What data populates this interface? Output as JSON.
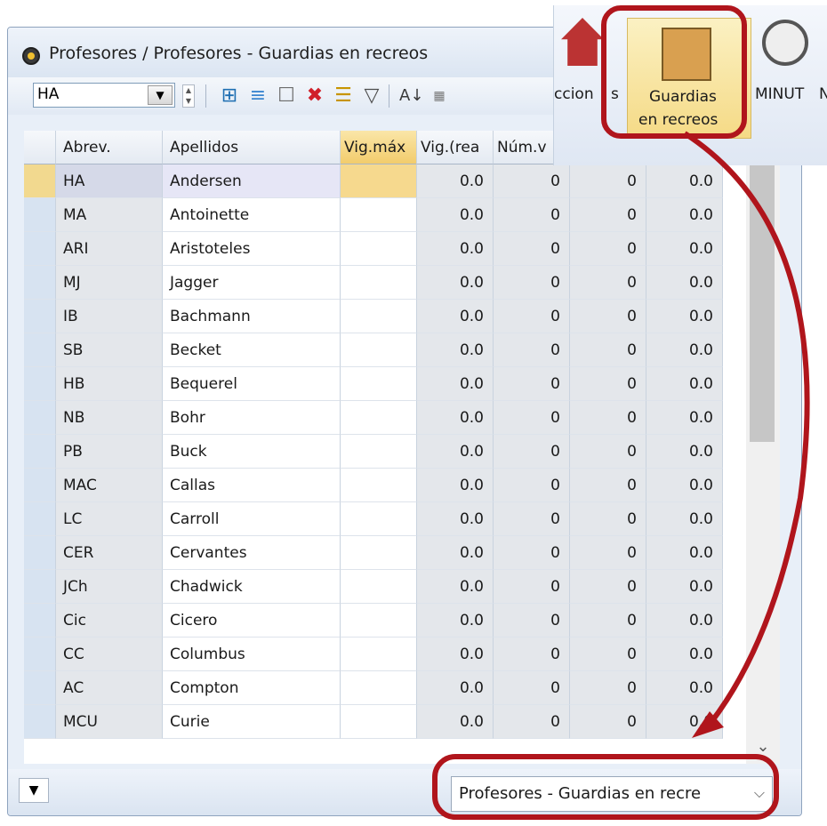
{
  "window": {
    "title": "Profesores / Profesores - Guardias en recreos"
  },
  "toolbar": {
    "combo_value": "HA"
  },
  "columns": [
    "Abrev.",
    "Apellidos",
    "Vig.máx",
    "Vig.(rea",
    "Núm.v",
    "",
    "",
    ""
  ],
  "rows": [
    [
      "HA",
      "Andersen",
      "",
      "0.0",
      "0",
      "0",
      "0.0"
    ],
    [
      "MA",
      "Antoinette",
      "",
      "0.0",
      "0",
      "0",
      "0.0"
    ],
    [
      "ARI",
      "Aristoteles",
      "",
      "0.0",
      "0",
      "0",
      "0.0"
    ],
    [
      "MJ",
      "Jagger",
      "",
      "0.0",
      "0",
      "0",
      "0.0"
    ],
    [
      "IB",
      "Bachmann",
      "",
      "0.0",
      "0",
      "0",
      "0.0"
    ],
    [
      "SB",
      "Becket",
      "",
      "0.0",
      "0",
      "0",
      "0.0"
    ],
    [
      "HB",
      "Bequerel",
      "",
      "0.0",
      "0",
      "0",
      "0.0"
    ],
    [
      "NB",
      "Bohr",
      "",
      "0.0",
      "0",
      "0",
      "0.0"
    ],
    [
      "PB",
      "Buck",
      "",
      "0.0",
      "0",
      "0",
      "0.0"
    ],
    [
      "MAC",
      "Callas",
      "",
      "0.0",
      "0",
      "0",
      "0.0"
    ],
    [
      "LC",
      "Carroll",
      "",
      "0.0",
      "0",
      "0",
      "0.0"
    ],
    [
      "CER",
      "Cervantes",
      "",
      "0.0",
      "0",
      "0",
      "0.0"
    ],
    [
      "JCh",
      "Chadwick",
      "",
      "0.0",
      "0",
      "0",
      "0.0"
    ],
    [
      "Cic",
      "Cicero",
      "",
      "0.0",
      "0",
      "0",
      "0.0"
    ],
    [
      "CC",
      "Columbus",
      "",
      "0.0",
      "0",
      "0",
      "0.0"
    ],
    [
      "AC",
      "Compton",
      "",
      "0.0",
      "0",
      "0",
      "0.0"
    ],
    [
      "MCU",
      "Curie",
      "",
      "0.0",
      "0",
      "0",
      "0.0"
    ]
  ],
  "bottom": {
    "view_select": "Profesores - Guardias en recre"
  },
  "ribbon": {
    "left_label": "ccion",
    "left_label2": "s",
    "guardias_line1": "Guardias",
    "guardias_line2": "en recreos",
    "right_label": "MINUT",
    "right_label2": "N"
  },
  "colors": {
    "callout": "#b0151c",
    "selected_cell": "#f6d98e"
  }
}
